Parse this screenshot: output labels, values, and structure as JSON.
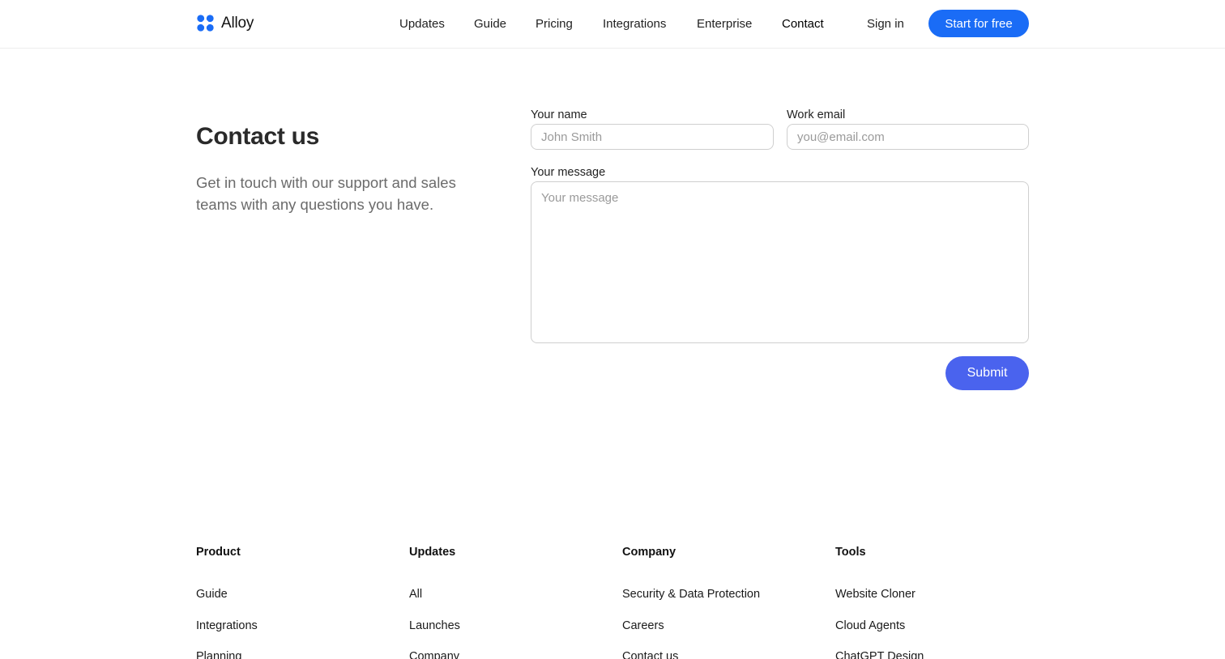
{
  "header": {
    "brand": "Alloy",
    "nav": [
      {
        "label": "Updates",
        "active": false
      },
      {
        "label": "Guide",
        "active": false
      },
      {
        "label": "Pricing",
        "active": false
      },
      {
        "label": "Integrations",
        "active": false
      },
      {
        "label": "Enterprise",
        "active": false
      },
      {
        "label": "Contact",
        "active": true
      }
    ],
    "signin_label": "Sign in",
    "cta_label": "Start for free"
  },
  "intro": {
    "title": "Contact us",
    "subtitle": "Get in touch with our support and sales teams with any questions you have."
  },
  "form": {
    "name_label": "Your name",
    "name_placeholder": "John Smith",
    "name_value": "",
    "email_label": "Work email",
    "email_placeholder": "you@email.com",
    "email_value": "",
    "message_label": "Your message",
    "message_placeholder": "Your message",
    "message_value": "",
    "submit_label": "Submit"
  },
  "footer": {
    "columns": [
      {
        "heading": "Product",
        "links": [
          "Guide",
          "Integrations",
          "Planning"
        ]
      },
      {
        "heading": "Updates",
        "links": [
          "All",
          "Launches",
          "Company"
        ]
      },
      {
        "heading": "Company",
        "links": [
          "Security & Data Protection",
          "Careers",
          "Contact us"
        ]
      },
      {
        "heading": "Tools",
        "links": [
          "Website Cloner",
          "Cloud Agents",
          "ChatGPT Design"
        ]
      }
    ]
  },
  "colors": {
    "brand_blue": "#1a6cf6",
    "submit_blue": "#4a63ee"
  },
  "icons": {
    "logo": "alloy-logo-icon"
  }
}
